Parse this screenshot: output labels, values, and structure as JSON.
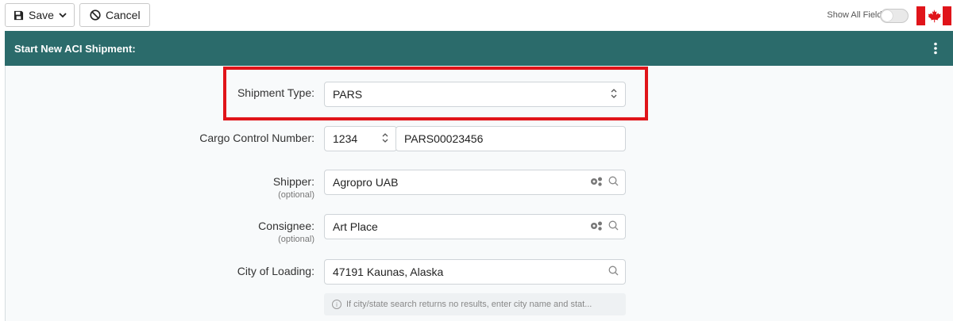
{
  "toolbar": {
    "save_label": "Save",
    "cancel_label": "Cancel",
    "show_all_label": "Show All Fields",
    "show_all_enabled": false,
    "country_flag": "canada-flag-icon"
  },
  "header": {
    "title": "Start New ACI Shipment:",
    "color": "#2b6b6b",
    "menu_icon": "kebab-menu-icon"
  },
  "form": {
    "shipment_type": {
      "label": "Shipment Type:",
      "value": "PARS"
    },
    "cargo_control": {
      "label": "Cargo Control Number:",
      "prefix": "1234",
      "value": "PARS00023456"
    },
    "shipper": {
      "label": "Shipper:",
      "optional": "(optional)",
      "value": "Agropro UAB"
    },
    "consignee": {
      "label": "Consignee:",
      "optional": "(optional)",
      "value": "Art Place"
    },
    "city_of_loading": {
      "label": "City of Loading:",
      "value": "47191 Kaunas, Alaska"
    },
    "hint": "If city/state search returns no results, enter city name and stat..."
  },
  "colors": {
    "highlight": "#e0141a",
    "header_bg": "#2b6b6b"
  }
}
